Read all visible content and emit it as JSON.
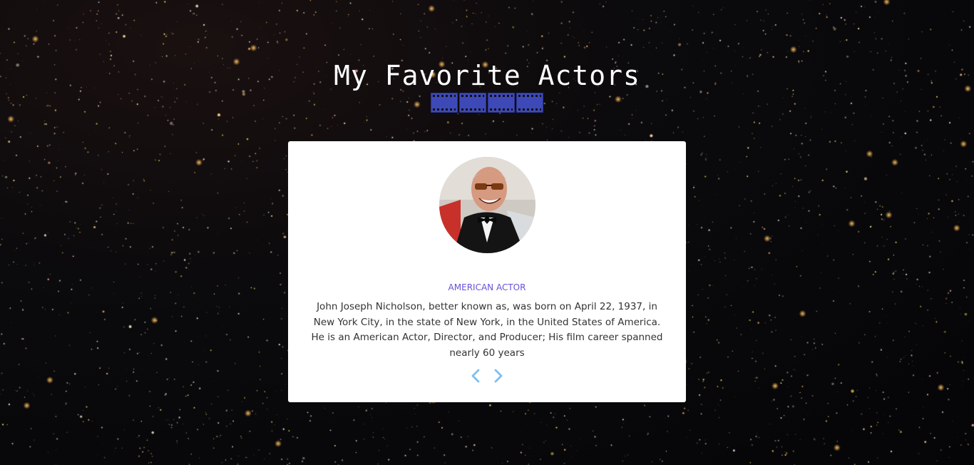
{
  "page": {
    "title": "My Favorite Actors"
  },
  "actor": {
    "occupation": "AMERICAN ACTOR",
    "bio": "John Joseph Nicholson, better known as, was born on April 22, 1937, in New York City, in the state of New York, in the United States of America. He is an American Actor, Director, and Producer; His film career spanned nearly 60 years"
  },
  "icons": {
    "title_decoration": "film-strip-icon",
    "previous": "chevron-left-icon",
    "next": "chevron-right-icon"
  },
  "colors": {
    "background": "#050507",
    "title": "#ffffff",
    "film_strip": "#3e49b8",
    "card": "#ffffff",
    "occupation": "#6b4fd8",
    "bio_text": "#333333",
    "arrows": "#7fbfee"
  }
}
